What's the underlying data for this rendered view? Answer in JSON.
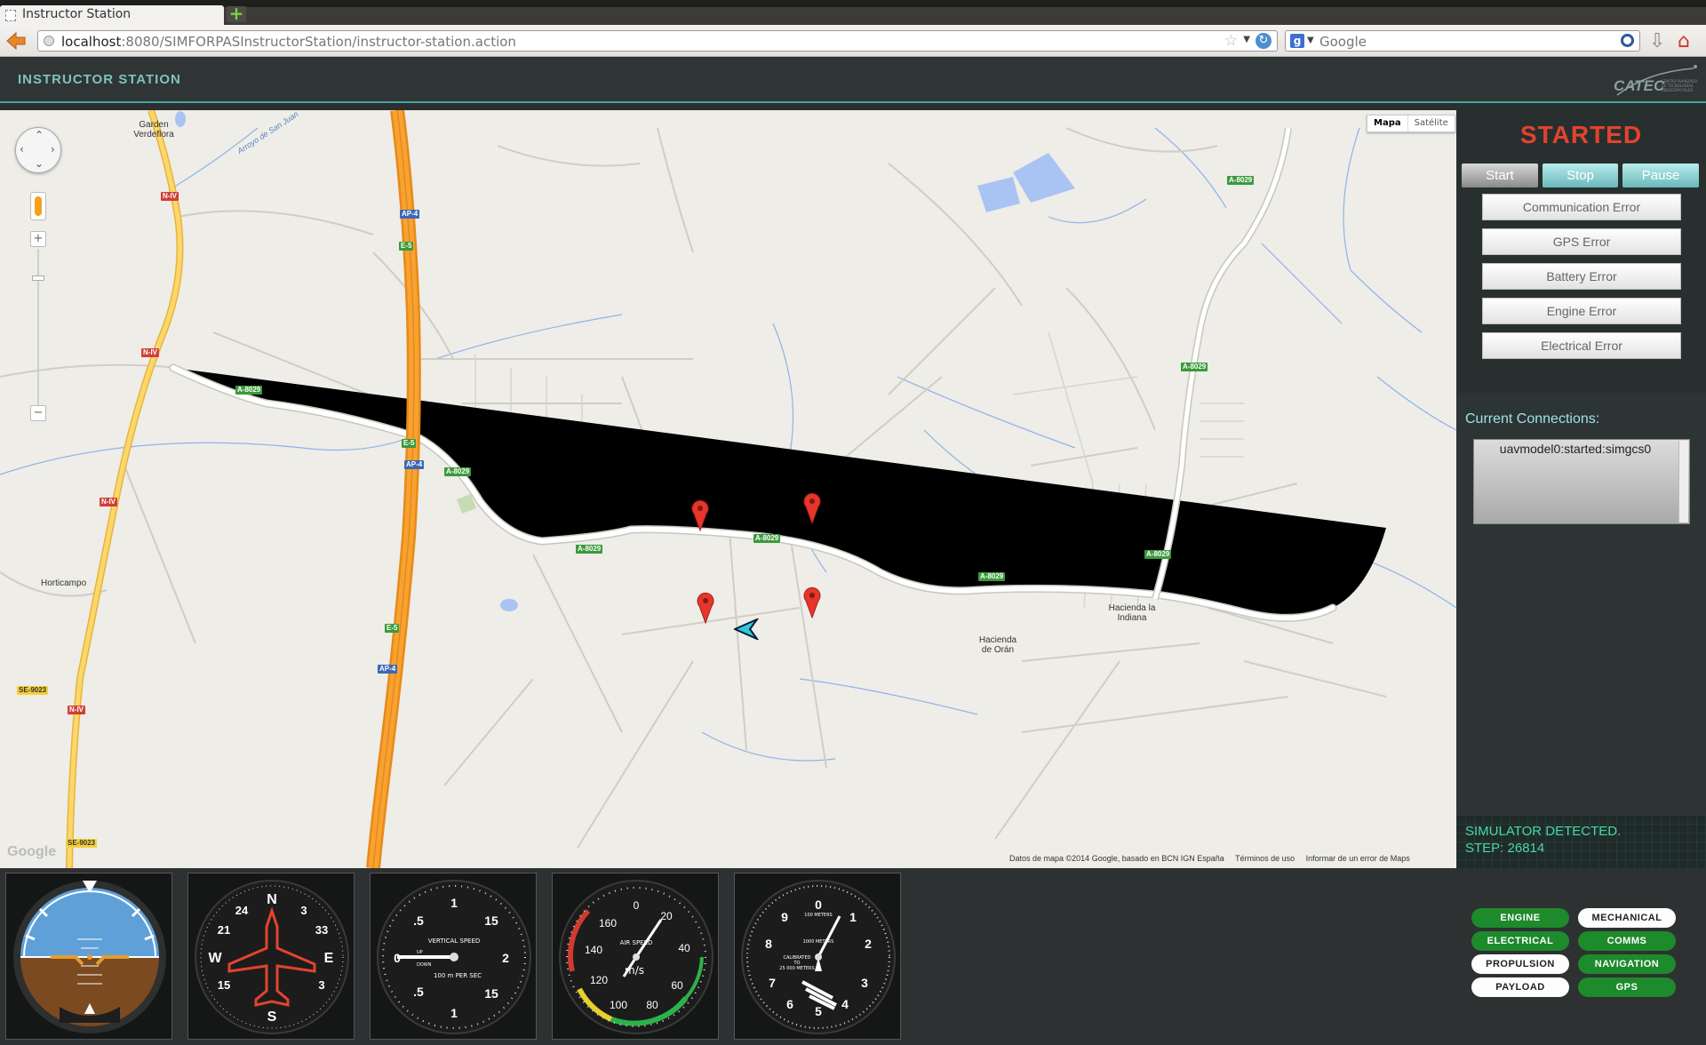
{
  "browser": {
    "tab_title": "Instructor Station",
    "url_host": "localhost",
    "url_rest": ":8080/SIMFORPASInstructorStation/instructor-station.action",
    "search_placeholder": "Google"
  },
  "header": {
    "title": "INSTRUCTOR STATION",
    "logo_text": "CATEC",
    "logo_subtext": "CENTRO AVANZADO DE TECNOLOGÍAS AEROESPACIALES"
  },
  "map": {
    "type_buttons": [
      "Mapa",
      "Satélite"
    ],
    "places": [
      "Garden Verdeflora",
      "Arroyo de San Juan",
      "Horticampo",
      "Hacienda la Indiana",
      "Hacienda de Orán"
    ],
    "road_labels": {
      "n4": "N-IV",
      "ap4": "AP-4",
      "e5": "E-5",
      "a8029": "A-8029",
      "se9023": "SE-9023"
    },
    "footer": [
      "Datos de mapa ©2014 Google, basado en BCN IGN España",
      "Términos de uso",
      "Informar de un error de Maps"
    ],
    "google": "Google"
  },
  "control": {
    "status": "STARTED",
    "start": "Start",
    "stop": "Stop",
    "pause": "Pause",
    "errors": [
      "Communication Error",
      "GPS Error",
      "Battery Error",
      "Engine Error",
      "Electrical Error"
    ],
    "connections_label": "Current Connections:",
    "connections": [
      "uavmodel0:started:simgcs0"
    ],
    "sim_detected": "SIMULATOR DETECTED.",
    "step": "STEP: 26814"
  },
  "instruments": {
    "vs_title": "VERTICAL SPEED",
    "vs_up": "UP",
    "vs_down": "DOWN",
    "vs_units": "100 m PER SEC",
    "as_title": "AIR SPEED",
    "as_units": "m/s",
    "alt_title": "100 METERS",
    "alt_sub1": "1000 METERS",
    "alt_sub2": "CALIBRATED",
    "alt_sub3": "TO",
    "alt_sub4": "25 000 METERS"
  },
  "systems": {
    "engine": "ENGINE",
    "mechanical": "MECHANICAL",
    "electrical": "ELECTRICAL",
    "comms": "COMMS",
    "propulsion": "PROPULSION",
    "navigation": "NAVIGATION",
    "payload": "PAYLOAD",
    "gps": "GPS",
    "colors": {
      "ok": "#1d8a2b",
      "off": "#fdfdfd"
    }
  }
}
